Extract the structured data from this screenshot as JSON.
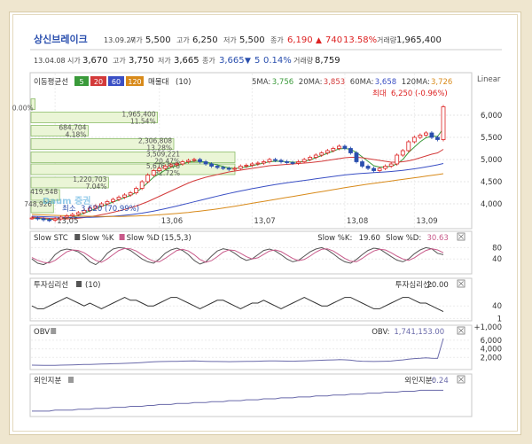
{
  "header": {
    "name": "상신브레이크",
    "date": "13.09.27",
    "open_label": "시가",
    "open": "5,500",
    "high_label": "고가",
    "high": "6,250",
    "low_label": "저가",
    "low": "5,500",
    "close_label": "종가",
    "close": "6,190",
    "change_arrow": "▲",
    "change": "740",
    "change_pct": "13.58%",
    "volume_label": "거래량",
    "volume": "1,965,400"
  },
  "subheader": {
    "date": "13.04.08",
    "open_label": "시가",
    "open": "3,670",
    "high_label": "고가",
    "high": "3,750",
    "low_label": "저가",
    "low": "3,665",
    "close_label": "종가",
    "close": "3,665",
    "change_arrow": "▼",
    "change": "5",
    "change_pct": "0.14%",
    "volume_label": "거래량",
    "volume": "8,759"
  },
  "main_panel": {
    "ma_title": "이동평균선",
    "ma_periods": [
      "5",
      "20",
      "60",
      "120"
    ],
    "ma_colors": [
      "#3a9a3a",
      "#d33a3a",
      "#3a4fc4",
      "#d88a1a"
    ],
    "volume_profile_title": "매물대",
    "volume_profile_param": "(10)",
    "ma_readouts": [
      {
        "label": "5MA:",
        "value": "3,756",
        "color": "#3a9a3a"
      },
      {
        "label": "20MA:",
        "value": "3,853",
        "color": "#d33a3a"
      },
      {
        "label": "60MA:",
        "value": "3,658",
        "color": "#3a4fc4"
      },
      {
        "label": "120MA:",
        "value": "3,726",
        "color": "#d88a1a"
      }
    ],
    "scale_label": "Linear",
    "max_label": "최대",
    "max_value": "6,250 (-0.96%)",
    "min_label": "최소",
    "min_value": "3,620 (70.99%)",
    "watermark": "Daum 증권"
  },
  "chart_data": [
    {
      "type": "candlestick",
      "title": "",
      "x_labels": [
        "13,05",
        "13,06",
        "13,07",
        "13,08",
        "13,09"
      ],
      "y_ticks": [
        "6,000",
        "5,500",
        "5,000",
        "4,500",
        "4,000"
      ],
      "ylim": [
        3500,
        6700
      ],
      "close": [
        3680,
        3665,
        3640,
        3630,
        3660,
        3700,
        3730,
        3760,
        3800,
        3850,
        3900,
        3950,
        4000,
        4050,
        4100,
        4150,
        4200,
        4250,
        4350,
        4500,
        4650,
        4750,
        4800,
        4850,
        4880,
        4900,
        4950,
        4980,
        5000,
        4950,
        4900,
        4850,
        4820,
        4800,
        4780,
        4800,
        4850,
        4870,
        4900,
        4920,
        4950,
        5000,
        4980,
        4950,
        4930,
        4920,
        4950,
        5000,
        5050,
        5100,
        5150,
        5200,
        5250,
        5300,
        5250,
        5150,
        4950,
        4850,
        4800,
        4750,
        4800,
        4850,
        4900,
        5100,
        5200,
        5400,
        5500,
        5550,
        5600,
        5500,
        5450,
        6190
      ],
      "ma_series": [
        {
          "name": "5MA",
          "values": [
            3680,
            3670,
            3660,
            3650,
            3650,
            3660,
            3680,
            3700,
            3740,
            3790,
            3840,
            3890,
            3940,
            3990,
            4040,
            4090,
            4140,
            4190,
            4260,
            4360,
            4480,
            4600,
            4680,
            4760,
            4820,
            4860,
            4900,
            4940,
            4960,
            4960,
            4940,
            4910,
            4880,
            4840,
            4810,
            4800,
            4810,
            4830,
            4860,
            4890,
            4920,
            4950,
            4960,
            4960,
            4950,
            4940,
            4940,
            4960,
            4990,
            5040,
            5090,
            5140,
            5190,
            5240,
            5250,
            5230,
            5160,
            5060,
            4960,
            4860,
            4830,
            4830,
            4850,
            4900,
            5000,
            5160,
            5280,
            5400,
            5490,
            5530,
            5520,
            5700
          ]
        },
        {
          "name": "20MA",
          "values": [
            3700,
            3690,
            3680,
            3670,
            3665,
            3660,
            3660,
            3665,
            3675,
            3690,
            3710,
            3730,
            3755,
            3780,
            3810,
            3840,
            3875,
            3910,
            3950,
            4000,
            4050,
            4110,
            4170,
            4230,
            4290,
            4350,
            4410,
            4470,
            4520,
            4560,
            4600,
            4630,
            4660,
            4690,
            4720,
            4740,
            4760,
            4780,
            4800,
            4820,
            4840,
            4860,
            4870,
            4880,
            4890,
            4900,
            4910,
            4920,
            4930,
            4945,
            4960,
            4980,
            5000,
            5020,
            5040,
            5050,
            5050,
            5040,
            5020,
            5000,
            4980,
            4960,
            4940,
            4940,
            4950,
            4970,
            5000,
            5040,
            5080,
            5120,
            5150,
            5230
          ]
        },
        {
          "name": "60MA",
          "values": [
            3720,
            3715,
            3710,
            3705,
            3700,
            3698,
            3696,
            3695,
            3694,
            3695,
            3697,
            3700,
            3705,
            3712,
            3720,
            3730,
            3742,
            3756,
            3772,
            3790,
            3812,
            3836,
            3862,
            3890,
            3920,
            3950,
            3982,
            4014,
            4046,
            4078,
            4110,
            4142,
            4174,
            4204,
            4234,
            4262,
            4290,
            4316,
            4342,
            4366,
            4390,
            4412,
            4434,
            4454,
            4474,
            4492,
            4510,
            4528,
            4546,
            4564,
            4582,
            4600,
            4618,
            4636,
            4652,
            4666,
            4678,
            4688,
            4696,
            4704,
            4712,
            4720,
            4730,
            4742,
            4756,
            4772,
            4790,
            4810,
            4832,
            4856,
            4880,
            4910
          ]
        },
        {
          "name": "120MA",
          "values": [
            3760,
            3755,
            3750,
            3745,
            3740,
            3736,
            3732,
            3728,
            3725,
            3722,
            3720,
            3718,
            3717,
            3716,
            3716,
            3717,
            3719,
            3722,
            3726,
            3731,
            3737,
            3744,
            3752,
            3761,
            3771,
            3782,
            3794,
            3807,
            3821,
            3836,
            3852,
            3869,
            3887,
            3906,
            3926,
            3947,
            3968,
            3990,
            4012,
            4034,
            4056,
            4078,
            4100,
            4122,
            4144,
            4166,
            4188,
            4210,
            4232,
            4254,
            4276,
            4298,
            4320,
            4342,
            4364,
            4386,
            4406,
            4426,
            4444,
            4462,
            4480,
            4498,
            4516,
            4534,
            4552,
            4570,
            4588,
            4606,
            4624,
            4642,
            4660,
            4680
          ]
        }
      ],
      "volume_profile": [
        {
          "label": "1,965,400",
          "pct": "11.54%",
          "level": 5950,
          "size": 0.62
        },
        {
          "label": "684,704",
          "pct": "4.18%",
          "level": 5650,
          "size": 0.28
        },
        {
          "label": "2,306,808",
          "pct": "13.28%",
          "level": 5350,
          "size": 0.7
        },
        {
          "label": "3,509,221",
          "pct": "20.47%",
          "level": 5050,
          "size": 1.0
        },
        {
          "label": "5,676,878",
          "pct": "32.72%",
          "level": 4780,
          "size": 1.0
        },
        {
          "label": "1,220,703",
          "pct": "7.04%",
          "level": 4480,
          "size": 0.38
        },
        {
          "label": "419,548",
          "pct": "",
          "level": 4200,
          "size": 0.14
        },
        {
          "label": "748,926",
          "pct": "",
          "level": 3920,
          "size": 0.11
        },
        {
          "label": "",
          "pct": "0.00%",
          "level": 6250,
          "size": 0.02
        }
      ]
    },
    {
      "type": "line",
      "title": "Slow STC",
      "series": [
        {
          "name": "Slow %K",
          "value": "19.60",
          "color": "#555555",
          "values": [
            40,
            25,
            20,
            30,
            55,
            70,
            75,
            72,
            65,
            50,
            30,
            20,
            35,
            60,
            75,
            80,
            78,
            70,
            55,
            40,
            30,
            25,
            40,
            60,
            72,
            78,
            70,
            55,
            35,
            22,
            30,
            50,
            68,
            76,
            72,
            60,
            45,
            35,
            40,
            55,
            70,
            75,
            68,
            55,
            40,
            30,
            35,
            50,
            65,
            75,
            80,
            72,
            58,
            42,
            30,
            25,
            38,
            55,
            70,
            78,
            75,
            62,
            48,
            36,
            30,
            40,
            58,
            72,
            80,
            76,
            60,
            55
          ]
        },
        {
          "name": "Slow %D",
          "value": "30.63",
          "color": "#c85a8a",
          "values": [
            45,
            35,
            28,
            26,
            35,
            50,
            65,
            72,
            70,
            62,
            48,
            35,
            28,
            40,
            55,
            70,
            77,
            76,
            68,
            55,
            42,
            32,
            30,
            42,
            56,
            70,
            74,
            68,
            55,
            38,
            28,
            34,
            48,
            64,
            72,
            70,
            60,
            48,
            40,
            44,
            56,
            68,
            72,
            66,
            54,
            42,
            34,
            38,
            50,
            64,
            74,
            76,
            68,
            55,
            42,
            32,
            30,
            42,
            56,
            68,
            74,
            72,
            62,
            50,
            40,
            35,
            44,
            58,
            70,
            76,
            72,
            62
          ]
        }
      ],
      "y_ticks": [
        "80",
        "40"
      ],
      "ylim": [
        0,
        100
      ],
      "param": "(15,5,3)"
    },
    {
      "type": "line",
      "title": "투자심리선",
      "param": "(10)",
      "series": [
        {
          "name": "투자심리선",
          "value": "20.00",
          "color": "#333333",
          "values": [
            40,
            30,
            30,
            40,
            50,
            60,
            70,
            60,
            50,
            40,
            50,
            40,
            30,
            40,
            50,
            60,
            70,
            60,
            60,
            50,
            40,
            40,
            50,
            60,
            70,
            70,
            60,
            50,
            40,
            30,
            40,
            50,
            60,
            60,
            50,
            40,
            30,
            40,
            50,
            50,
            60,
            50,
            40,
            30,
            40,
            50,
            60,
            70,
            60,
            50,
            40,
            40,
            50,
            60,
            70,
            70,
            60,
            50,
            40,
            30,
            30,
            40,
            50,
            60,
            70,
            70,
            60,
            50,
            50,
            40,
            30,
            20
          ]
        }
      ],
      "y_ticks": [
        "40"
      ],
      "ylim": [
        0,
        100
      ]
    },
    {
      "type": "line",
      "title": "OBV",
      "series": [
        {
          "name": "OBV",
          "value": "1,741,153.00",
          "color": "#6a6aaa",
          "values": [
            200,
            180,
            160,
            150,
            170,
            200,
            230,
            260,
            300,
            340,
            380,
            420,
            460,
            500,
            540,
            580,
            620,
            660,
            720,
            800,
            900,
            980,
            1020,
            1060,
            1080,
            1100,
            1140,
            1160,
            1180,
            1140,
            1100,
            1060,
            1040,
            1020,
            1000,
            1020,
            1060,
            1080,
            1100,
            1120,
            1150,
            1190,
            1170,
            1150,
            1130,
            1120,
            1150,
            1190,
            1230,
            1280,
            1330,
            1380,
            1430,
            1480,
            1440,
            1360,
            1200,
            1120,
            1080,
            1040,
            1080,
            1120,
            1160,
            1320,
            1420,
            1600,
            1720,
            1800,
            1900,
            1820,
            1780,
            6400
          ]
        }
      ],
      "y_ticks": [
        "+1,000",
        "6,000",
        "4,000",
        "2,000"
      ],
      "ylim": [
        0,
        7000
      ]
    },
    {
      "type": "line",
      "title": "외인지분",
      "series": [
        {
          "name": "외인지분",
          "value": "0.24",
          "color": "#6a6aaa",
          "values": [
            0.02,
            0.02,
            0.02,
            0.02,
            0.03,
            0.03,
            0.03,
            0.03,
            0.04,
            0.04,
            0.04,
            0.05,
            0.05,
            0.05,
            0.06,
            0.06,
            0.06,
            0.07,
            0.07,
            0.07,
            0.08,
            0.08,
            0.09,
            0.09,
            0.09,
            0.1,
            0.1,
            0.1,
            0.11,
            0.11,
            0.11,
            0.12,
            0.12,
            0.12,
            0.13,
            0.13,
            0.13,
            0.14,
            0.14,
            0.14,
            0.15,
            0.15,
            0.15,
            0.16,
            0.16,
            0.16,
            0.17,
            0.17,
            0.17,
            0.18,
            0.18,
            0.18,
            0.19,
            0.19,
            0.19,
            0.2,
            0.2,
            0.2,
            0.21,
            0.21,
            0.21,
            0.22,
            0.22,
            0.22,
            0.23,
            0.23,
            0.23,
            0.24,
            0.24,
            0.24,
            0.24,
            0.24
          ]
        }
      ],
      "y_ticks": [
        "1"
      ],
      "ylim": [
        0,
        0.3
      ]
    }
  ]
}
